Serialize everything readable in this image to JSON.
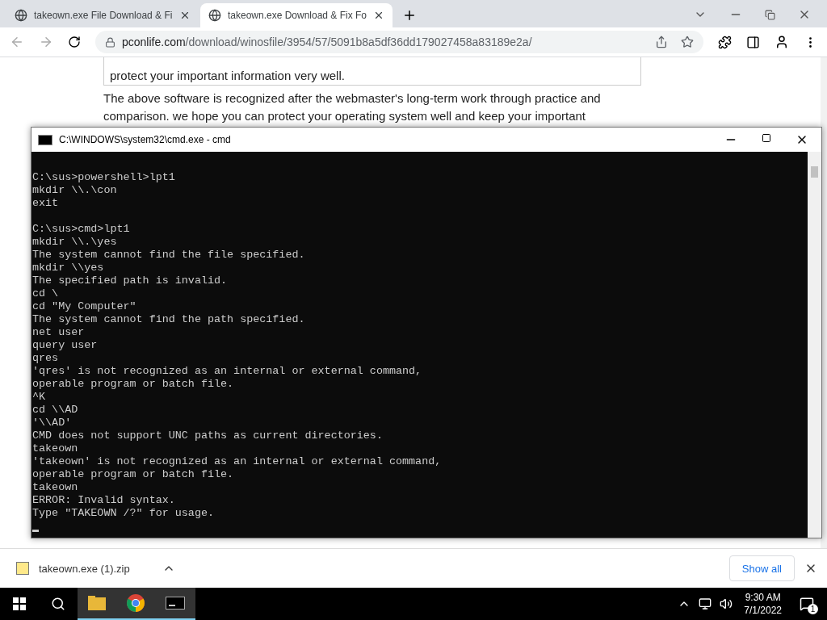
{
  "browser": {
    "tabs": [
      {
        "title": "takeown.exe File Download & Fi",
        "selected": false
      },
      {
        "title": "takeown.exe Download & Fix Fo",
        "selected": true
      }
    ],
    "address": {
      "domain": "pconlife.com",
      "path": "/download/winosfile/3954/57/5091b8a5df36dd179027458a83189e2a/"
    }
  },
  "page": {
    "boxed_text": [
      "protect your important information very well."
    ],
    "paragraph": [
      "The above software is recognized after the webmaster's long-term work through practice and",
      "comparison. we hope you can protect your operating system well and keep your important"
    ]
  },
  "console": {
    "title": "C:\\WINDOWS\\system32\\cmd.exe - cmd",
    "blocks": [
      [
        "C:\\sus>powershell>lpt1",
        "mkdir \\\\.\\con",
        "exit"
      ],
      [
        "C:\\sus>cmd>lpt1",
        "mkdir \\\\.\\yes",
        "The system cannot find the file specified.",
        "mkdir \\\\yes",
        "The specified path is invalid.",
        "cd \\",
        "cd \"My Computer\"",
        "The system cannot find the path specified.",
        "net user",
        "query user",
        "qres",
        "'qres' is not recognized as an internal or external command,",
        "operable program or batch file.",
        "^K",
        "cd \\\\AD",
        "'\\\\AD'",
        "CMD does not support UNC paths as current directories.",
        "takeown",
        "'takeown' is not recognized as an internal or external command,",
        "operable program or batch file.",
        "takeown",
        "ERROR: Invalid syntax.",
        "Type \"TAKEOWN /?\" for usage."
      ]
    ]
  },
  "downloads": {
    "file": "takeown.exe (1).zip",
    "show_all": "Show all"
  },
  "taskbar": {
    "time": "9:30 AM",
    "date": "7/1/2022",
    "notifications": "1"
  }
}
